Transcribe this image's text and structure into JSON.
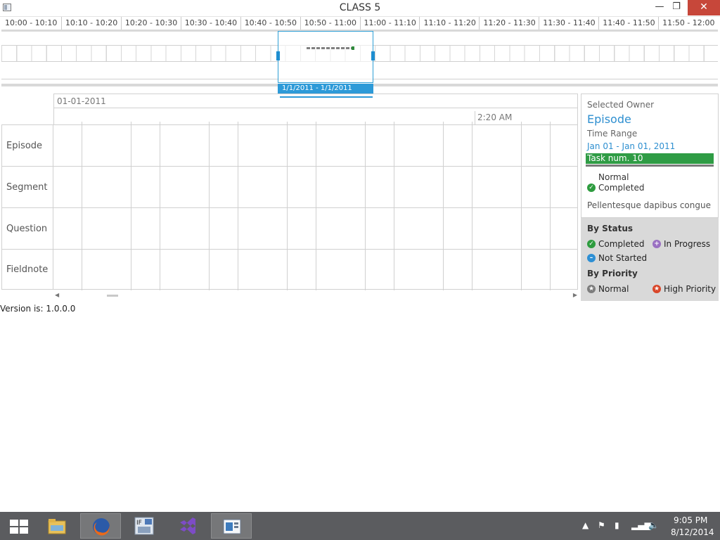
{
  "window": {
    "title": "CLASS 5",
    "minimize": "—",
    "maximize": "❐",
    "close": "✕"
  },
  "timeline": {
    "ticks": [
      "10:00 - 10:10",
      "10:10 - 10:20",
      "10:20 - 10:30",
      "10:30 - 10:40",
      "10:40 - 10:50",
      "10:50 - 11:00",
      "11:00 - 11:10",
      "11:10 - 11:20",
      "11:20 - 11:30",
      "11:30 - 11:40",
      "11:40 - 11:50",
      "11:50 - 12:00"
    ],
    "selection_label": "1/1/2011 - 1/1/2011"
  },
  "gantt": {
    "date": "01-01-2011",
    "time_label": "2:20 AM",
    "rows": [
      "Episode",
      "Segment",
      "Question",
      "Fieldnote"
    ]
  },
  "version": "Version is: 1.0.0.0",
  "panel": {
    "selected_owner_label": "Selected Owner",
    "owner": "Episode",
    "time_range_label": "Time Range",
    "time_range": "Jan 01 - Jan 01, 2011",
    "task": "Task num. 10",
    "priority": "Normal",
    "status": "Completed",
    "description": "Pellentesque dapibus congue"
  },
  "legend": {
    "by_status": "By Status",
    "completed": "Completed",
    "in_progress": "In Progress",
    "not_started": "Not Started",
    "by_priority": "By Priority",
    "normal": "Normal",
    "high_priority": "High Priority"
  },
  "taskbar": {
    "apps": [
      "file-explorer-icon",
      "firefox-icon",
      "if-app-icon",
      "visual-studio-icon",
      "class5-app-icon"
    ],
    "time": "9:05 PM",
    "date": "8/12/2014"
  },
  "colors": {
    "accent": "#2d9ad8",
    "task": "#2f9c45",
    "close": "#c7473a",
    "taskbar": "#5b5c5f"
  }
}
